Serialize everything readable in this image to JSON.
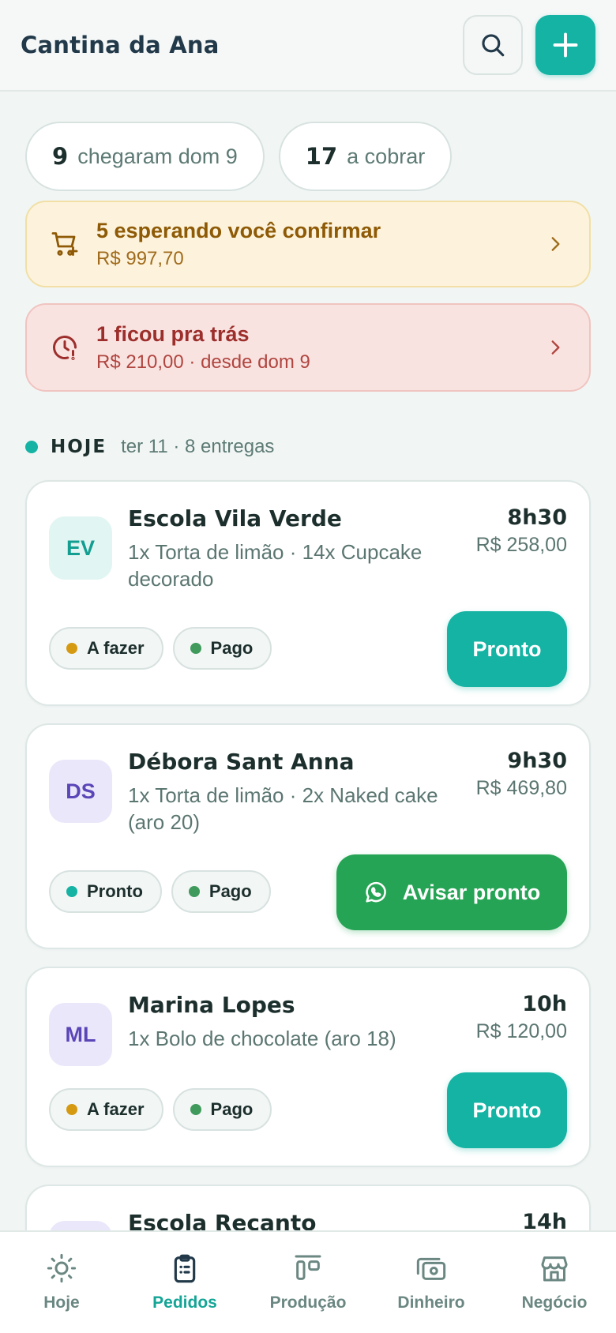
{
  "header": {
    "title": "Cantina da Ana",
    "search_icon": "search-icon",
    "add_icon": "plus-icon"
  },
  "stats": [
    {
      "count": "9",
      "label": "chegaram dom 9"
    },
    {
      "count": "17",
      "label": "a cobrar"
    }
  ],
  "alerts": {
    "pending": {
      "title": "5 esperando você confirmar",
      "subtitle": "R$ 997,70",
      "icon": "cart-plus-icon",
      "color": "#8e5a06"
    },
    "overdue": {
      "title": "1 ficou pra trás",
      "subtitle": "R$ 210,00 · desde dom 9",
      "icon": "clock-alert-icon",
      "color": "#9c2f2c"
    }
  },
  "day": {
    "label": "HOJE",
    "info": "ter 11 · 8 entregas"
  },
  "orders": [
    {
      "initials": "EV",
      "name": "Escola Vila Verde",
      "items": "1x Torta de limão · 14x Cupcake decorado",
      "time": "8h30",
      "price": "R$ 258,00",
      "status": "A fazer",
      "payment": "Pago",
      "action": "Pronto"
    },
    {
      "initials": "DS",
      "name": "Débora Sant Anna",
      "items": "1x Torta de limão · 2x Naked cake (aro 20)",
      "time": "9h30",
      "price": "R$ 469,80",
      "status": "Pronto",
      "payment": "Pago",
      "action": "Avisar pronto"
    },
    {
      "initials": "ML",
      "name": "Marina Lopes",
      "items": "1x Bolo de chocolate (aro 18)",
      "time": "10h",
      "price": "R$ 120,00",
      "status": "A fazer",
      "payment": "Pago",
      "action": "Pronto"
    },
    {
      "initials": "",
      "name": "Escola Recanto",
      "time": "14h"
    }
  ],
  "tabs": [
    {
      "label": "Hoje",
      "icon": "sun-icon"
    },
    {
      "label": "Pedidos",
      "icon": "clipboard-icon",
      "active": true
    },
    {
      "label": "Produção",
      "icon": "production-icon"
    },
    {
      "label": "Dinheiro",
      "icon": "money-icon"
    },
    {
      "label": "Negócio",
      "icon": "store-icon"
    }
  ],
  "colors": {
    "accent": "#14b3a3",
    "whatsapp_green": "#26a455",
    "status_todo": "#d59a12",
    "status_paid": "#3f9a5c"
  }
}
